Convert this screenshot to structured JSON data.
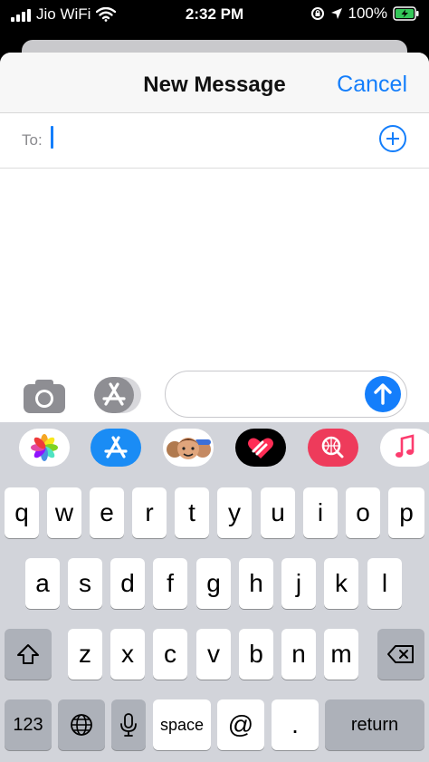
{
  "status_bar": {
    "carrier": "Jio WiFi",
    "time": "2:32 PM",
    "battery": "100%"
  },
  "header": {
    "title": "New Message",
    "cancel": "Cancel"
  },
  "to_field": {
    "label": "To:"
  },
  "drawer": {
    "apps": [
      "photos",
      "app-store",
      "memoji",
      "digital-touch",
      "web-search",
      "music"
    ]
  },
  "keyboard": {
    "row1": [
      "q",
      "w",
      "e",
      "r",
      "t",
      "y",
      "u",
      "i",
      "o",
      "p"
    ],
    "row2": [
      "a",
      "s",
      "d",
      "f",
      "g",
      "h",
      "j",
      "k",
      "l"
    ],
    "row3": [
      "z",
      "x",
      "c",
      "v",
      "b",
      "n",
      "m"
    ],
    "numbers_key": "123",
    "space_key": "space",
    "at_key": "@",
    "period_key": ".",
    "return_key": "return"
  },
  "colors": {
    "accent": "#147efb",
    "keyboard_bg": "#d2d4da",
    "key_dark": "#adb1b9"
  }
}
